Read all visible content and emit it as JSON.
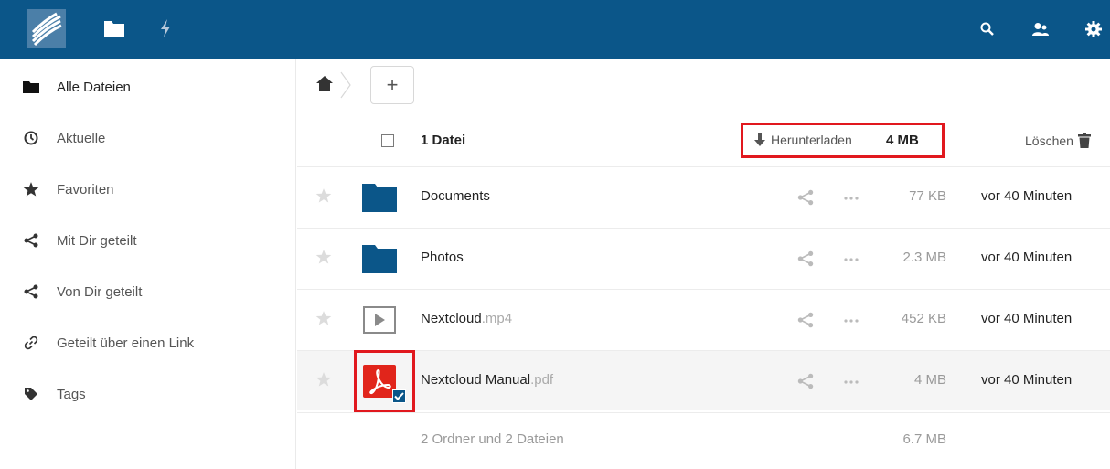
{
  "colors": {
    "topbar": "#0b5689",
    "highlight": "#e1181e",
    "folder": "#0b5689",
    "pdf": "#e1251b"
  },
  "topbar": {
    "apps": [
      {
        "name": "files",
        "icon": "folder-icon"
      },
      {
        "name": "activity",
        "icon": "lightning-icon"
      }
    ],
    "right_icons": [
      "search-icon",
      "contacts-icon",
      "settings-gear-icon"
    ]
  },
  "sidebar": {
    "items": [
      {
        "label": "Alle Dateien",
        "icon": "folder-icon",
        "active": true
      },
      {
        "label": "Aktuelle",
        "icon": "clock-icon"
      },
      {
        "label": "Favoriten",
        "icon": "star-icon"
      },
      {
        "label": "Mit Dir geteilt",
        "icon": "share-icon"
      },
      {
        "label": "Von Dir geteilt",
        "icon": "share-icon"
      },
      {
        "label": "Geteilt über einen Link",
        "icon": "link-icon"
      },
      {
        "label": "Tags",
        "icon": "tag-icon"
      }
    ]
  },
  "toolbar": {
    "new_label": "+"
  },
  "selection": {
    "count_label": "1 Datei",
    "download_label": "Herunterladen",
    "size": "4 MB",
    "delete_label": "Löschen"
  },
  "files": [
    {
      "name": "Documents",
      "ext": "",
      "type": "folder",
      "size": "77 KB",
      "modified": "vor 40 Minuten",
      "selected": false
    },
    {
      "name": "Photos",
      "ext": "",
      "type": "folder",
      "size": "2.3 MB",
      "modified": "vor 40 Minuten",
      "selected": false
    },
    {
      "name": "Nextcloud",
      "ext": ".mp4",
      "type": "video",
      "size": "452 KB",
      "modified": "vor 40 Minuten",
      "selected": false
    },
    {
      "name": "Nextcloud Manual",
      "ext": ".pdf",
      "type": "pdf",
      "size": "4 MB",
      "modified": "vor 40 Minuten",
      "selected": true
    }
  ],
  "summary": {
    "text": "2 Ordner und 2 Dateien",
    "size": "6.7 MB"
  }
}
